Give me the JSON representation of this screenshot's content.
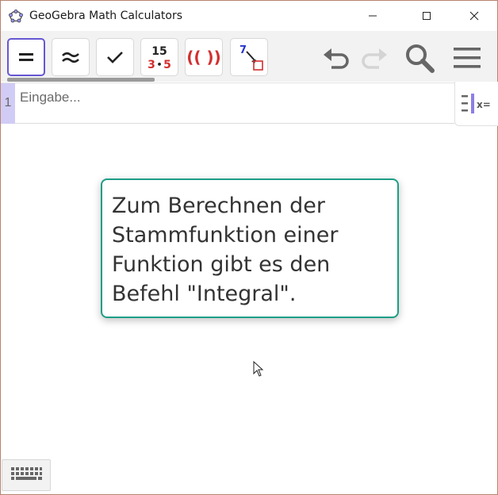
{
  "window": {
    "title": "GeoGebra Math Calculators",
    "icons": [
      "geogebra-logo-icon",
      "minimize-icon",
      "maximize-icon",
      "close-icon"
    ]
  },
  "toolbar": {
    "tools": [
      {
        "name": "equals-tool",
        "icon": "equals-icon",
        "selected": true
      },
      {
        "name": "approx-tool",
        "icon": "approx-icon"
      },
      {
        "name": "check-tool",
        "icon": "check-icon"
      },
      {
        "name": "factor-tool",
        "icon": "factor-icon",
        "top": "15",
        "bottom_a": "3",
        "bottom_dot": "•",
        "bottom_b": "5"
      },
      {
        "name": "expand-tool",
        "icon": "parentheses-icon",
        "label": "(( ))"
      },
      {
        "name": "substitute-tool",
        "icon": "substitute-icon",
        "label": "7"
      }
    ],
    "right_icons": [
      "undo-icon",
      "redo-icon",
      "search-icon",
      "menu-icon"
    ]
  },
  "algebra": {
    "row_number": "1",
    "input_placeholder": "Eingabe...",
    "side_icon": "algebra-view-icon",
    "side_icon_label": "x="
  },
  "tooltip": {
    "text": "Zum Berechnen der\nStammfunktion einer\nFunktion gibt es den\nBefehl \"Integral\"."
  },
  "colors": {
    "accent": "#6557d2",
    "tooltip_border": "#1e9e86",
    "row_number_bg": "#d1ccf5",
    "factor_red": "#d32f2f"
  },
  "bottom": {
    "keyboard_icon": "keyboard-icon"
  }
}
